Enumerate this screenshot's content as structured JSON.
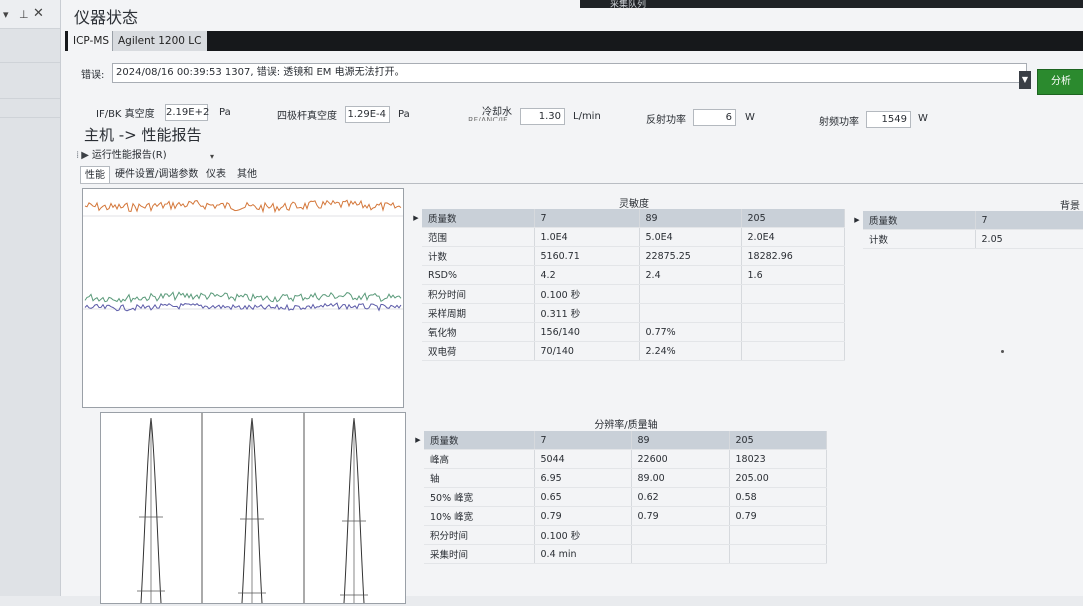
{
  "window": {
    "title": "仪器状态",
    "top_right_caption": "采集队列"
  },
  "tabs": [
    {
      "label": "ICP-MS",
      "active": true
    },
    {
      "label": "Agilent 1200 LC",
      "active": false
    }
  ],
  "error": {
    "label": "错误:",
    "message": "2024/08/16 00:39:53 1307, 错误: 透镜和 EM 电源无法打开。",
    "analyze_button": "分析"
  },
  "status": {
    "ifbk_label": "IF/BK 真空度",
    "ifbk_value": "2.19E+2",
    "ifbk_unit": "Pa",
    "quad_label": "四极杆真空度",
    "quad_value": "1.29E-4",
    "quad_unit": "Pa",
    "coolant_label": "冷却水",
    "coolant_sub": "RF/ANC/IF",
    "coolant_value": "1.30",
    "coolant_unit": "L/min",
    "reflected_label": "反射功率",
    "reflected_value": "6",
    "reflected_unit": "W",
    "rf_label": "射频功率",
    "rf_value": "1549",
    "rf_unit": "W"
  },
  "report": {
    "title": "主机 -> 性能报告",
    "run_label": "运行性能报告(R)",
    "subtabs": [
      "性能",
      "硬件设置/调谐参数",
      "仪表",
      "其他"
    ]
  },
  "sensitivity": {
    "title": "灵敏度",
    "rows": [
      {
        "label": "质量数",
        "c1": "7",
        "c2": "89",
        "c3": "205"
      },
      {
        "label": "范围",
        "c1": "1.0E4",
        "c2": "5.0E4",
        "c3": "2.0E4"
      },
      {
        "label": "计数",
        "c1": "5160.71",
        "c2": "22875.25",
        "c3": "18282.96"
      },
      {
        "label": "RSD%",
        "c1": "4.2",
        "c2": "2.4",
        "c3": "1.6"
      },
      {
        "label": "积分时间",
        "c1": "0.100 秒",
        "c2": "",
        "c3": ""
      },
      {
        "label": "采样周期",
        "c1": "0.311 秒",
        "c2": "",
        "c3": ""
      },
      {
        "label": "氧化物",
        "c1": "156/140",
        "c2": "0.77%",
        "c3": ""
      },
      {
        "label": "双电荷",
        "c1": "70/140",
        "c2": "2.24%",
        "c3": ""
      }
    ]
  },
  "background": {
    "title": "背景",
    "rows": [
      {
        "label": "质量数",
        "c1": "7"
      },
      {
        "label": "计数",
        "c1": "2.05"
      }
    ]
  },
  "resolution": {
    "title": "分辨率/质量轴",
    "rows": [
      {
        "label": "质量数",
        "c1": "7",
        "c2": "89",
        "c3": "205"
      },
      {
        "label": "峰高",
        "c1": "5044",
        "c2": "22600",
        "c3": "18023"
      },
      {
        "label": "轴",
        "c1": "6.95",
        "c2": "89.00",
        "c3": "205.00"
      },
      {
        "label": "50% 峰宽",
        "c1": "0.65",
        "c2": "0.62",
        "c3": "0.58"
      },
      {
        "label": "10% 峰宽",
        "c1": "0.79",
        "c2": "0.79",
        "c3": "0.79"
      },
      {
        "label": "积分时间",
        "c1": "0.100 秒",
        "c2": "",
        "c3": ""
      },
      {
        "label": "采集时间",
        "c1": "0.4 min",
        "c2": "",
        "c3": ""
      }
    ]
  },
  "colors": {
    "trace_orange": "#d4773a",
    "trace_green": "#5a9a7a",
    "trace_purple": "#5b5aa8",
    "analyze_green": "#2b8a2e",
    "table_header": "#c9d0d8"
  }
}
